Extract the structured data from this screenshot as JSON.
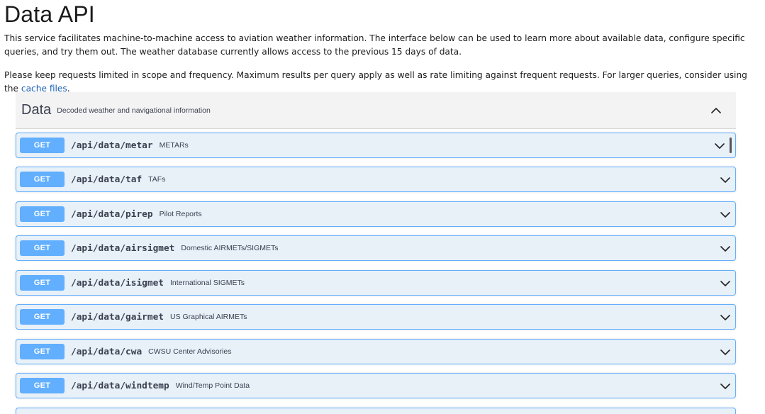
{
  "page": {
    "title": "Data API",
    "intro": "This service facilitates machine-to-machine access to aviation weather information. The interface below can be used to learn more about available data, configure specific queries, and try them out. The weather database currently allows access to the previous 15 days of data.",
    "notice_prefix": "Please keep requests limited in scope and frequency. Maximum results per query apply as well as rate limiting against frequent requests. For larger queries, consider using the ",
    "notice_link": "cache files",
    "notice_suffix": "."
  },
  "section": {
    "title": "Data",
    "description": "Decoded weather and navigational information",
    "toggle_icon": "chevron-up-icon"
  },
  "operations": [
    {
      "method": "GET",
      "path": "/api/data/metar",
      "summary": "METARs"
    },
    {
      "method": "GET",
      "path": "/api/data/taf",
      "summary": "TAFs"
    },
    {
      "method": "GET",
      "path": "/api/data/pirep",
      "summary": "Pilot Reports"
    },
    {
      "method": "GET",
      "path": "/api/data/airsigmet",
      "summary": "Domestic AIRMETs/SIGMETs"
    },
    {
      "method": "GET",
      "path": "/api/data/isigmet",
      "summary": "International SIGMETs"
    },
    {
      "method": "GET",
      "path": "/api/data/gairmet",
      "summary": "US Graphical AIRMETs"
    },
    {
      "method": "GET",
      "path": "/api/data/cwa",
      "summary": "CWSU Center Advisories"
    },
    {
      "method": "GET",
      "path": "/api/data/windtemp",
      "summary": "Wind/Temp Point Data"
    }
  ],
  "colors": {
    "get_accent": "#61affe",
    "get_background": "#e8f0f8",
    "link": "#1a5fb4"
  }
}
